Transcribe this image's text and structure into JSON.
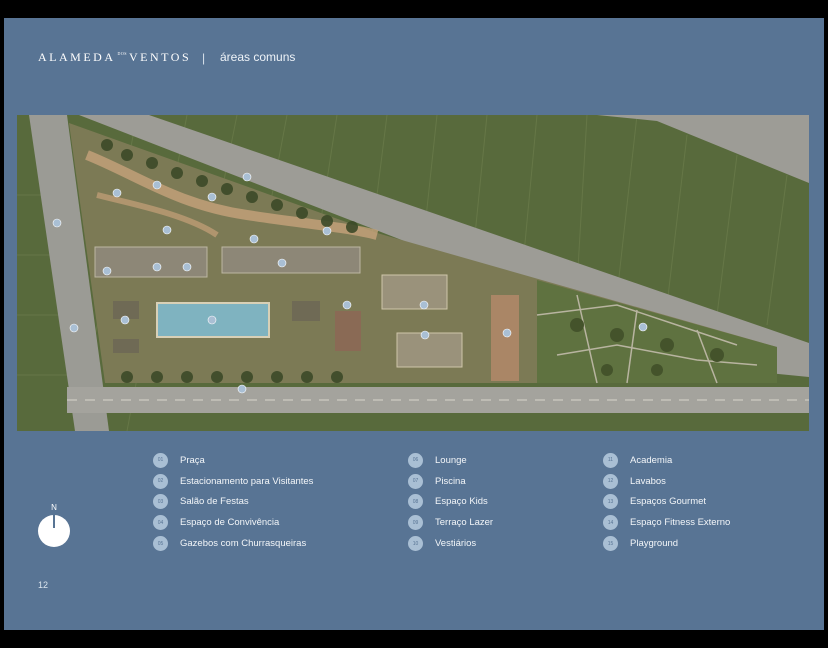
{
  "header": {
    "brand_left": "ALAMEDA",
    "brand_small": "DOS",
    "brand_right": "VENTOS",
    "separator": "|",
    "subtitle": "áreas comuns"
  },
  "legend": {
    "columns": [
      [
        {
          "num": "01",
          "label": "Praça"
        },
        {
          "num": "02",
          "label": "Estacionamento para Visitantes"
        },
        {
          "num": "03",
          "label": "Salão de Festas"
        },
        {
          "num": "04",
          "label": "Espaço de Convivência"
        },
        {
          "num": "05",
          "label": "Gazebos com Churrasqueiras"
        }
      ],
      [
        {
          "num": "06",
          "label": "Lounge"
        },
        {
          "num": "07",
          "label": "Piscina"
        },
        {
          "num": "08",
          "label": "Espaço Kids"
        },
        {
          "num": "09",
          "label": "Terraço Lazer"
        },
        {
          "num": "10",
          "label": "Vestiários"
        }
      ],
      [
        {
          "num": "11",
          "label": "Academia"
        },
        {
          "num": "12",
          "label": "Lavabos"
        },
        {
          "num": "13",
          "label": "Espaços Gourmet"
        },
        {
          "num": "14",
          "label": "Espaço Fitness Externo"
        },
        {
          "num": "15",
          "label": "Playground"
        }
      ]
    ]
  },
  "compass": {
    "label": "N"
  },
  "page_number": "12",
  "colors": {
    "page_background": "#587494",
    "frame": "#000000",
    "marker_fill": "#a9bfd4",
    "text": "#f3f6f9",
    "grass": "#55643b",
    "road": "#9a9a94"
  },
  "map_markers": [
    "01",
    "02",
    "03",
    "04",
    "05",
    "06",
    "07",
    "08",
    "09",
    "10",
    "11",
    "12",
    "13",
    "14",
    "15"
  ]
}
